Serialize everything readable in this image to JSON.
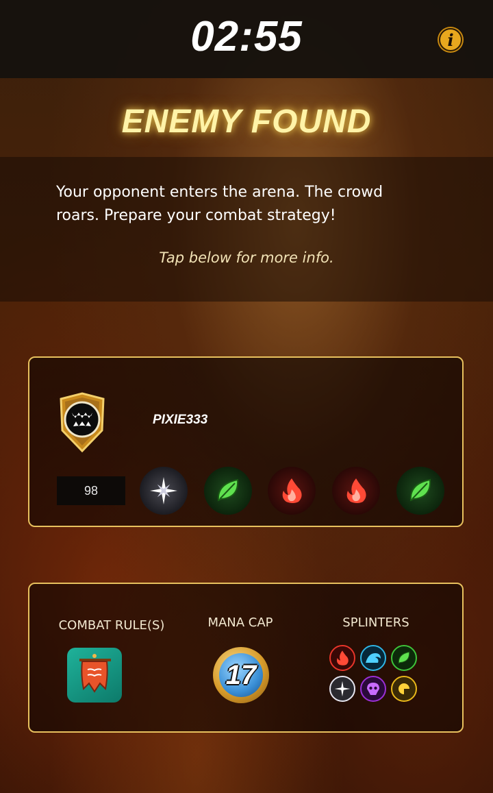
{
  "header": {
    "timer": "02:55",
    "info_icon": "info-icon"
  },
  "title": "ENEMY FOUND",
  "description": "Your opponent enters the arena. The crowd roars. Prepare your combat strategy!",
  "hint": "Tap below for more info.",
  "opponent": {
    "name": "PIXIE333",
    "rating": "98",
    "avatar_icon": "fangs-shield-icon",
    "splinters": [
      "life",
      "earth",
      "fire",
      "fire",
      "earth"
    ]
  },
  "rules": {
    "combat_rules_label": "COMBAT RULE(S)",
    "combat_rule_icon": "banner-flag-icon",
    "mana_cap_label": "MANA CAP",
    "mana_cap": "17",
    "splinters_label": "SPLINTERS",
    "allowed_splinters": [
      "fire",
      "water",
      "earth",
      "life",
      "death",
      "dragon"
    ]
  },
  "colors": {
    "accent_gold": "#e8c15e",
    "title_glow": "#fff3a8",
    "fire": "#e8352a",
    "water": "#2fb6e6",
    "earth": "#3ec43a",
    "life": "#e6e6f0",
    "death": "#9a2fd6",
    "dragon": "#e8b81a"
  }
}
